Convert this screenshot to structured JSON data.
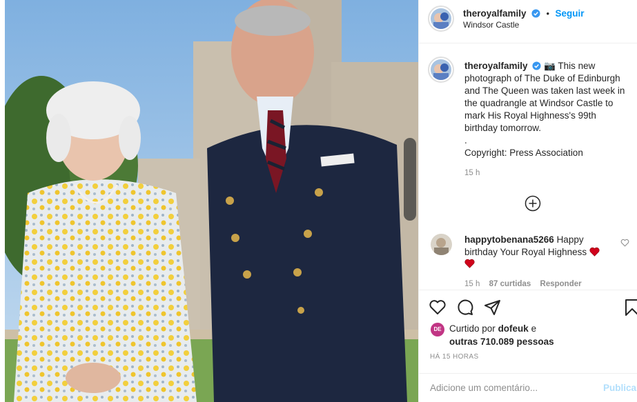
{
  "post": {
    "username": "theroyalfamily",
    "follow_label": "Seguir",
    "location": "Windsor Castle",
    "caption_username": "theroyalfamily",
    "caption_lines": [
      "📷 This new",
      "photograph of The Duke of Edinburgh",
      "and The Queen was taken last week in",
      "the quadrangle at Windsor Castle to",
      "mark His Royal Highness's 99th",
      "birthday tomorrow.",
      ".",
      "Copyright: Press Association"
    ],
    "caption_time": "15 h"
  },
  "comment": {
    "username": "happytobenana5266",
    "text_line1": "Happy",
    "text_line2": "birthday Your Royal Highness",
    "time": "15 h",
    "likes": "87 curtidas",
    "reply_label": "Responder"
  },
  "likes": {
    "prefix": "Curtido por",
    "user": "dofeuk",
    "connector": "e",
    "others": "outras 710.089 pessoas",
    "avatar_label": "DE"
  },
  "time_ago": "HÁ 15 HORAS",
  "comment_bar": {
    "placeholder": "Adicione um comentário...",
    "post_label": "Publicar"
  },
  "icons": {
    "verified": "verified-badge-icon",
    "heart": "heart-icon",
    "comment": "comment-icon",
    "share": "share-icon",
    "bookmark": "bookmark-icon",
    "add": "add-circle-icon"
  },
  "colors": {
    "accent": "#0095f6",
    "heart_red": "#ed4956",
    "muted": "#8e8e8e"
  }
}
